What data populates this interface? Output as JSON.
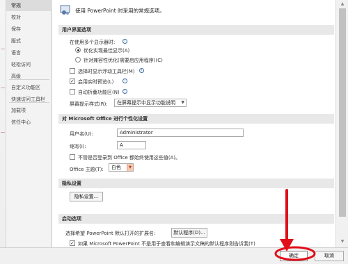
{
  "sidebar": {
    "items": [
      {
        "label": "常规",
        "active": true
      },
      {
        "label": "校对"
      },
      {
        "label": "保存"
      },
      {
        "label": "版式"
      },
      {
        "label": "语言"
      },
      {
        "label": "轻松访问"
      },
      {
        "label": "高级"
      },
      {
        "label": "自定义功能区"
      },
      {
        "label": "快速访问工具栏"
      },
      {
        "label": "加载项"
      },
      {
        "label": "信任中心"
      }
    ]
  },
  "header": {
    "text": "使用 PowerPoint 时采用的常规选项。"
  },
  "ui_section": {
    "title": "用户界面选项",
    "multi_display_label": "在使用多个显示器时:",
    "radio_best_appearance": "优化实现最佳显示(A)",
    "radio_compat": "针对兼容性优化(需要启应用程序)(C)",
    "cb_mini_toolbar": "选择时显示浮动工具栏(M)",
    "cb_live_preview": "启用实时预览(L)",
    "cb_collapse_ribbon": "自动折叠功能区(N)",
    "tip_style_label": "屏幕提示样式(R):",
    "tip_style_value": "在屏幕提示中显示功能说明"
  },
  "personalize": {
    "title": "对 Microsoft Office 进行个性化设置",
    "username_label": "用户名(U):",
    "username_value": "Administrator",
    "initials_label": "缩写(I):",
    "initials_value": "A",
    "always_use_label": "不管是否登录到 Office 都始终使用这些值(A)。",
    "theme_label": "Office 主题(T):",
    "theme_value": "白色"
  },
  "privacy": {
    "title": "隐私设置",
    "button": "隐私设置..."
  },
  "startup": {
    "title": "启动选项",
    "ext_label": "选择希望 PowerPoint 默认打开的扩展名:",
    "default_programs_button": "默认程序(D)...",
    "cb_default_label": "如果 Microsoft PowerPoint 不是用于查看和编辑演示文稿的默认程序则告诉我(T)"
  },
  "footer": {
    "ok": "确定",
    "cancel": "取消"
  },
  "colors": {
    "annotation_red": "#e0101a",
    "section_bg": "#e8e8e8",
    "sidebar_active": "#dcdcdc"
  }
}
